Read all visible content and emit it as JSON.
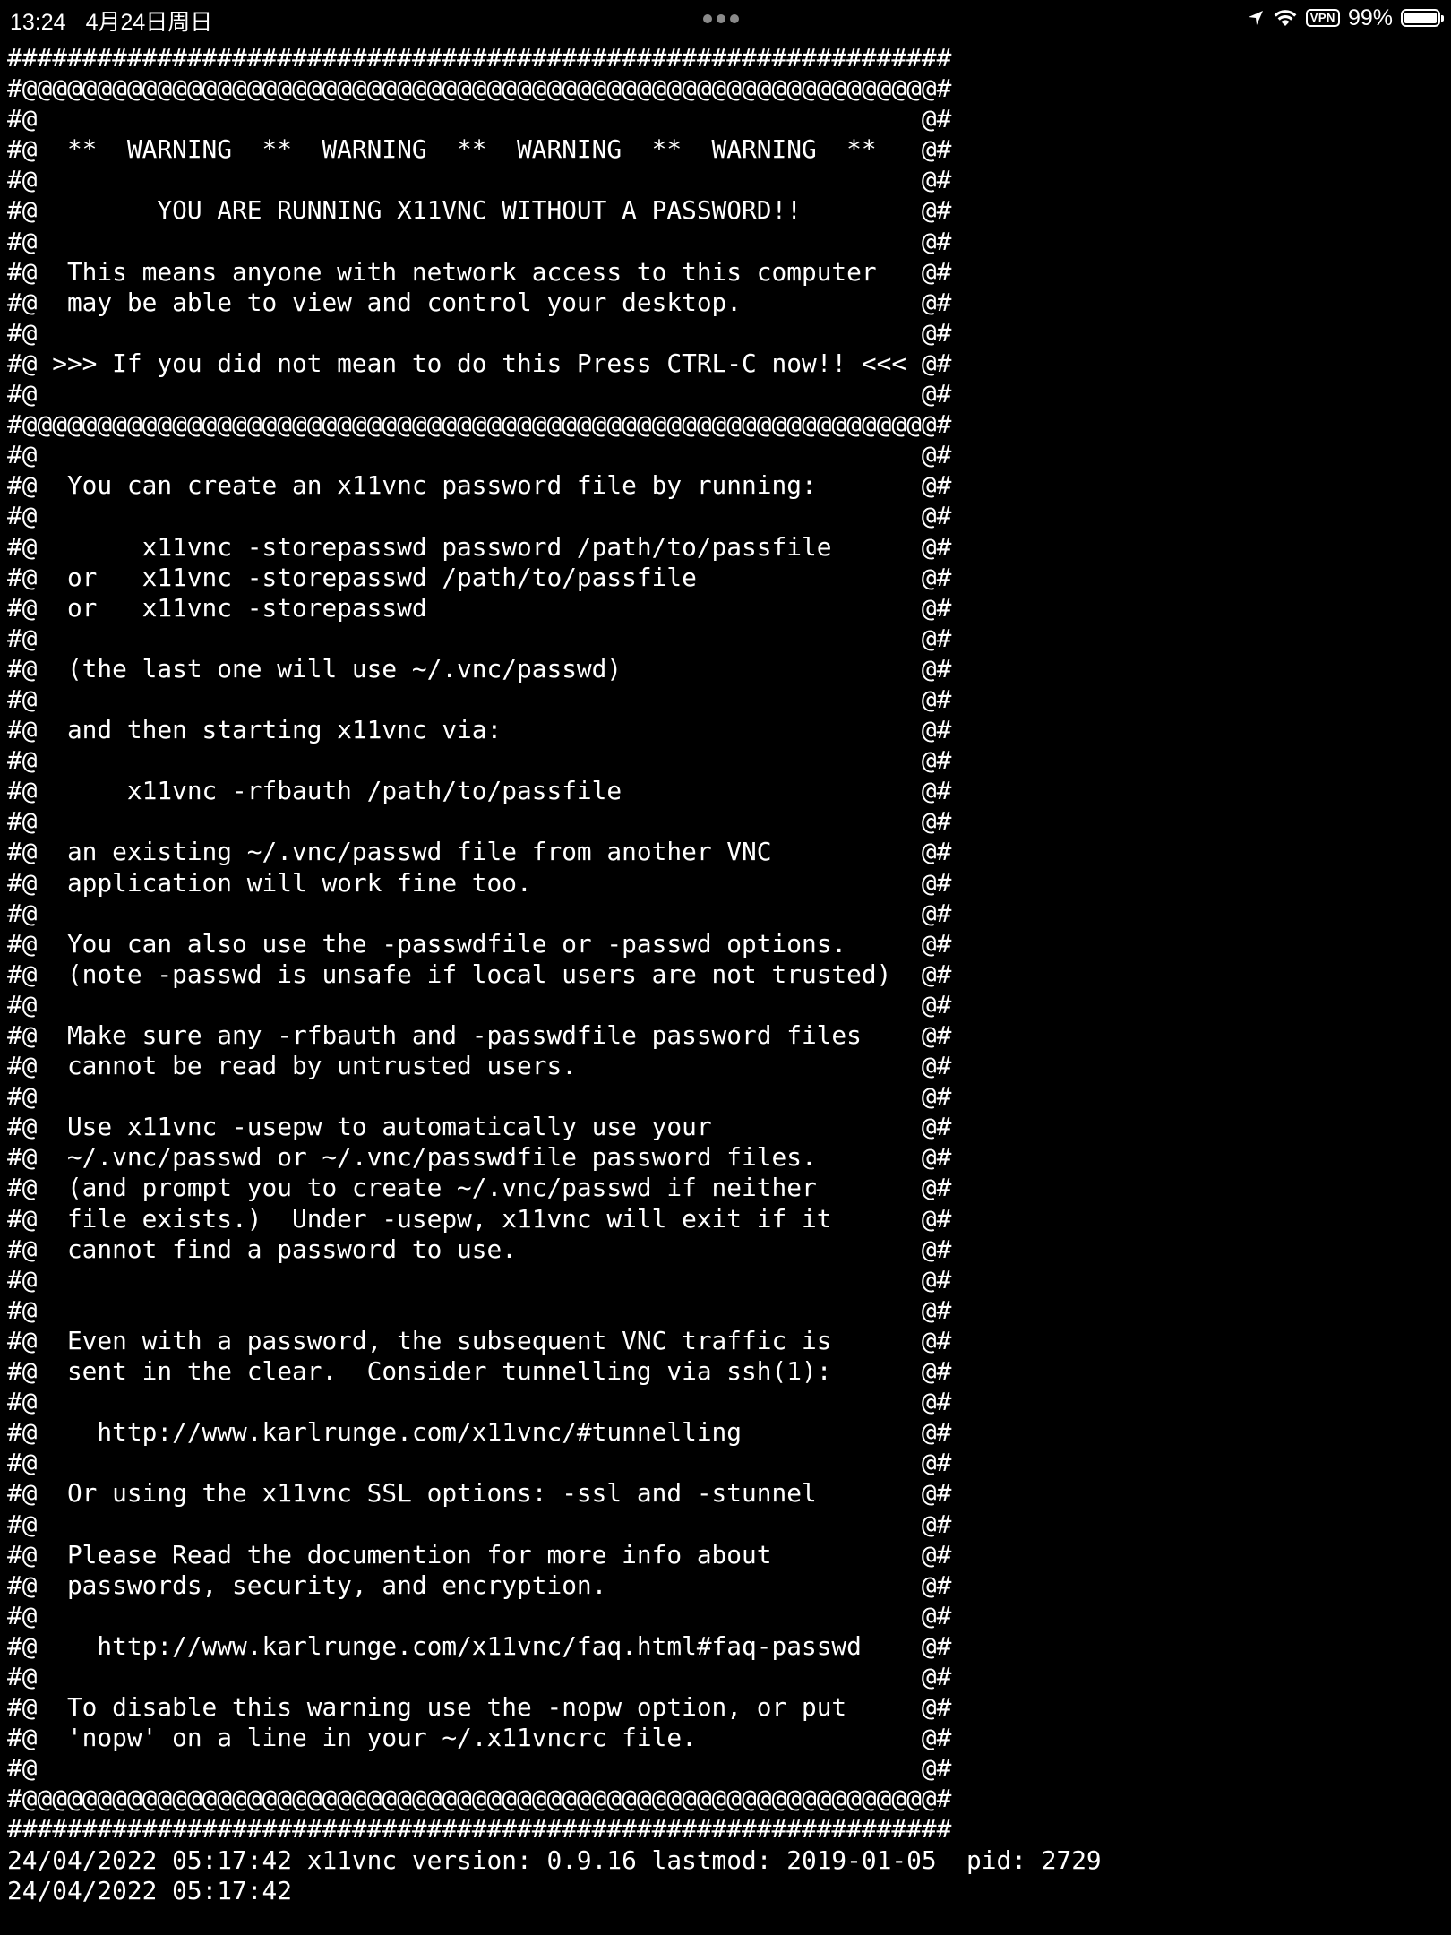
{
  "status_bar": {
    "time": "13:24",
    "date": "4月24日周日",
    "vpn_label": "VPN",
    "battery_percent": "99%",
    "battery_level": 0.99,
    "icons": [
      "location-arrow-icon",
      "wifi-icon",
      "vpn-icon",
      "battery-icon"
    ]
  },
  "terminal": {
    "background": "#000000",
    "foreground": "#ffffff",
    "lines": [
      "###############################################################",
      "#@@@@@@@@@@@@@@@@@@@@@@@@@@@@@@@@@@@@@@@@@@@@@@@@@@@@@@@@@@@@@#",
      "#@                                                           @#",
      "#@  **  WARNING  **  WARNING  **  WARNING  **  WARNING  **   @#",
      "#@                                                           @#",
      "#@        YOU ARE RUNNING X11VNC WITHOUT A PASSWORD!!        @#",
      "#@                                                           @#",
      "#@  This means anyone with network access to this computer   @#",
      "#@  may be able to view and control your desktop.            @#",
      "#@                                                           @#",
      "#@ >>> If you did not mean to do this Press CTRL-C now!! <<< @#",
      "#@                                                           @#",
      "#@@@@@@@@@@@@@@@@@@@@@@@@@@@@@@@@@@@@@@@@@@@@@@@@@@@@@@@@@@@@@#",
      "#@                                                           @#",
      "#@  You can create an x11vnc password file by running:       @#",
      "#@                                                           @#",
      "#@       x11vnc -storepasswd password /path/to/passfile      @#",
      "#@  or   x11vnc -storepasswd /path/to/passfile               @#",
      "#@  or   x11vnc -storepasswd                                 @#",
      "#@                                                           @#",
      "#@  (the last one will use ~/.vnc/passwd)                    @#",
      "#@                                                           @#",
      "#@  and then starting x11vnc via:                            @#",
      "#@                                                           @#",
      "#@      x11vnc -rfbauth /path/to/passfile                    @#",
      "#@                                                           @#",
      "#@  an existing ~/.vnc/passwd file from another VNC          @#",
      "#@  application will work fine too.                          @#",
      "#@                                                           @#",
      "#@  You can also use the -passwdfile or -passwd options.     @#",
      "#@  (note -passwd is unsafe if local users are not trusted)  @#",
      "#@                                                           @#",
      "#@  Make sure any -rfbauth and -passwdfile password files    @#",
      "#@  cannot be read by untrusted users.                       @#",
      "#@                                                           @#",
      "#@  Use x11vnc -usepw to automatically use your              @#",
      "#@  ~/.vnc/passwd or ~/.vnc/passwdfile password files.       @#",
      "#@  (and prompt you to create ~/.vnc/passwd if neither       @#",
      "#@  file exists.)  Under -usepw, x11vnc will exit if it      @#",
      "#@  cannot find a password to use.                           @#",
      "#@                                                           @#",
      "#@                                                           @#",
      "#@  Even with a password, the subsequent VNC traffic is      @#",
      "#@  sent in the clear.  Consider tunnelling via ssh(1):      @#",
      "#@                                                           @#",
      "#@    http://www.karlrunge.com/x11vnc/#tunnelling            @#",
      "#@                                                           @#",
      "#@  Or using the x11vnc SSL options: -ssl and -stunnel       @#",
      "#@                                                           @#",
      "#@  Please Read the documention for more info about          @#",
      "#@  passwords, security, and encryption.                     @#",
      "#@                                                           @#",
      "#@    http://www.karlrunge.com/x11vnc/faq.html#faq-passwd    @#",
      "#@                                                           @#",
      "#@  To disable this warning use the -nopw option, or put     @#",
      "#@  'nopw' on a line in your ~/.x11vncrc file.               @#",
      "#@                                                           @#",
      "#@@@@@@@@@@@@@@@@@@@@@@@@@@@@@@@@@@@@@@@@@@@@@@@@@@@@@@@@@@@@@#",
      "###############################################################",
      "24/04/2022 05:17:42 x11vnc version: 0.9.16 lastmod: 2019-01-05  pid: 2729",
      "24/04/2022 05:17:42"
    ]
  }
}
